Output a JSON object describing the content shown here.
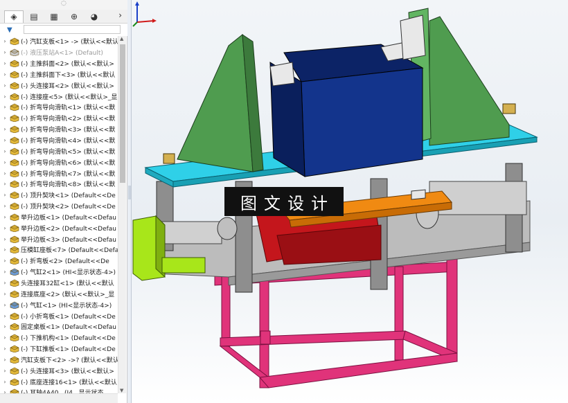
{
  "panel": {
    "more_glyph": "›",
    "filter_glyph": "▼",
    "tabs": [
      {
        "icon": "feature-manager-icon",
        "glyph": "◈"
      },
      {
        "icon": "property-manager-icon",
        "glyph": "▤"
      },
      {
        "icon": "configuration-manager-icon",
        "glyph": "▦"
      },
      {
        "icon": "dimxpert-icon",
        "glyph": "⊕"
      },
      {
        "icon": "display-manager-icon",
        "glyph": "◕"
      }
    ],
    "tree_items": [
      {
        "label": "(-) 汽缸支板<1> -> (默认<<默认",
        "icon": "part-icon"
      },
      {
        "label": "(-) 液压泵站A<1> (Default)",
        "icon": "part-icon-suppressed",
        "grey": true
      },
      {
        "label": "(-) 主推斜面<2> (默认<<默认>",
        "icon": "part-icon"
      },
      {
        "label": "(-) 主推斜面下<3> (默认<<默认",
        "icon": "part-icon"
      },
      {
        "label": "(-) 头连接耳<2> (默认<<默认>",
        "icon": "part-icon"
      },
      {
        "label": "(-) 连接座<5> (默认<<默认>_显",
        "icon": "part-icon"
      },
      {
        "label": "(-) 折弯导向滑轨<1> (默认<<默",
        "icon": "part-icon"
      },
      {
        "label": "(-) 折弯导向滑轨<2> (默认<<默",
        "icon": "part-icon"
      },
      {
        "label": "(-) 折弯导向滑轨<3> (默认<<默",
        "icon": "part-icon"
      },
      {
        "label": "(-) 折弯导向滑轨<4> (默认<<默",
        "icon": "part-icon"
      },
      {
        "label": "(-) 折弯导向滑轨<5> (默认<<默",
        "icon": "part-icon"
      },
      {
        "label": "(-) 折弯导向滑轨<6> (默认<<默",
        "icon": "part-icon"
      },
      {
        "label": "(-) 折弯导向滑轨<7> (默认<<默",
        "icon": "part-icon"
      },
      {
        "label": "(-) 折弯导向滑轨<8> (默认<<默",
        "icon": "part-icon"
      },
      {
        "label": "(-) 顶升契块<1> (Default<<De",
        "icon": "part-icon"
      },
      {
        "label": "(-) 顶升契块<2> (Default<<De",
        "icon": "part-icon"
      },
      {
        "label": "举升边板<1> (Default<<Defau",
        "icon": "part-icon"
      },
      {
        "label": "举升边板<2> (Default<<Defau",
        "icon": "part-icon"
      },
      {
        "label": "举升边板<3> (Default<<Defau",
        "icon": "part-icon"
      },
      {
        "label": "压模缸座板<7> (Default<<Defa",
        "icon": "part-icon"
      },
      {
        "label": "(-) 折弯板<2> (Default<<De",
        "icon": "part-icon"
      },
      {
        "label": "(-) 气缸2<1> (HI<显示状态-4>)",
        "icon": "assembly-icon"
      },
      {
        "label": "头连接耳32缸<1> (默认<<默认",
        "icon": "part-icon"
      },
      {
        "label": "连接底座<2> (默认<<默认>_显",
        "icon": "part-icon"
      },
      {
        "label": "(-) 气缸<1> (HI<显示状态-4>)",
        "icon": "assembly-icon"
      },
      {
        "label": "(-) 小折弯板<1> (Default<<De",
        "icon": "part-icon"
      },
      {
        "label": "固定桌板<1> (Default<<Defau",
        "icon": "part-icon"
      },
      {
        "label": "(-) 下推机构<1> (Default<<De",
        "icon": "part-icon"
      },
      {
        "label": "(-) 下缸推板<1> (Default<<De",
        "icon": "part-icon"
      },
      {
        "label": "汽缸支板下<2> ->? (默认<<默认",
        "icon": "part-icon"
      },
      {
        "label": "(-) 头连接耳<3> (默认<<默认>",
        "icon": "part-icon"
      },
      {
        "label": "(-) 底座连接16<1> (默认<<默认",
        "icon": "part-icon"
      },
      {
        "label": "(-) 耳轴4A40...(I4...显示状态",
        "icon": "part-icon"
      }
    ]
  },
  "viewport": {
    "watermark_text": "图文设计",
    "triad": {
      "icon": "axis-triad-icon"
    },
    "colors": {
      "bg_top": "#f2f5f8",
      "green_plate": "#4f9c4f",
      "blue_box": "#0e2a78",
      "cyan_plate": "#2fd0e8",
      "pink_frame": "#e0337a",
      "grey_plate": "#a6a6a6",
      "red_block": "#c4161c",
      "orange_bar": "#f08a12",
      "yellow_green": "#a8e61a"
    }
  }
}
